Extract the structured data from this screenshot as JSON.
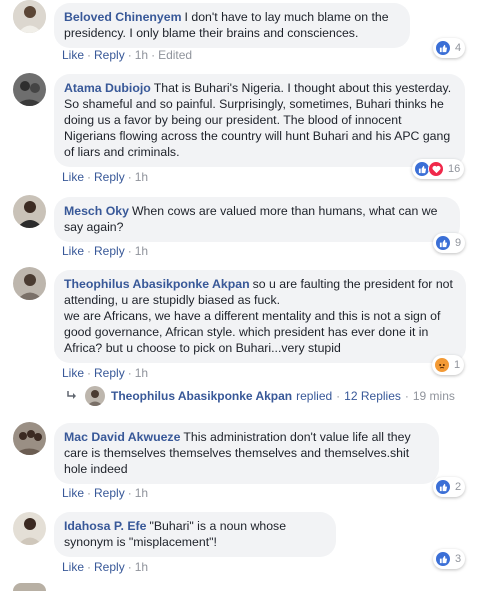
{
  "actions": {
    "like": "Like",
    "reply": "Reply",
    "separator": "·"
  },
  "comments": [
    {
      "author": "Beloved Chinenyem",
      "text": "I don't have to lay much blame on the presidency. I only blame their brains and consciences.",
      "time": "1h",
      "edited": "Edited",
      "reactions": {
        "types": [
          "like"
        ],
        "count": "4"
      }
    },
    {
      "author": "Atama Dubiojo",
      "text": "That is Buhari's Nigeria. I thought about this yesterday. So shameful and so painful. Surprisingly, sometimes, Buhari thinks he doing us a favor by being our president. The blood of innocent Nigerians flowing across the country will hunt Buhari and his APC gang of liars and criminals.",
      "time": "1h",
      "reactions": {
        "types": [
          "like",
          "love"
        ],
        "count": "16"
      }
    },
    {
      "author": "Mesch Oky",
      "text": "When cows are valued more than humans, what can we say again?",
      "time": "1h",
      "reactions": {
        "types": [
          "like"
        ],
        "count": "9"
      }
    },
    {
      "author": "Theophilus Abasikponke Akpan",
      "text": "so u are faulting the president for not attending, u are stupidly biased as fuck.",
      "text2": "we are Africans, we have a different mentality and this is not a sign of good governance, African style. which president has ever done it in Africa? but u choose to pick on Buhari...very stupid",
      "time": "1h",
      "reactions": {
        "types": [
          "angry"
        ],
        "count": "1"
      }
    },
    {
      "author": "Mac David Akwueze",
      "text": "This administration don't value life all they care is themselves themselves themselves and themselves.shit hole indeed",
      "time": "1h",
      "reactions": {
        "types": [
          "like"
        ],
        "count": "2"
      }
    },
    {
      "author": "Idahosa P. Efe",
      "text": "\"Buhari\" is a noun whose synonym is \"misplacement\"!",
      "time": "1h",
      "reactions": {
        "types": [
          "like"
        ],
        "count": "3"
      }
    }
  ],
  "reply_summary": {
    "author": "Theophilus Abasikponke Akpan",
    "action": "replied",
    "count_label": "12 Replies",
    "time": "19 mins"
  },
  "colors": {
    "link": "#385898",
    "bubble": "#f2f3f5",
    "meta": "#90949c",
    "like": "#3b6fd6",
    "love": "#f0284a",
    "angry": "#f39a35"
  }
}
